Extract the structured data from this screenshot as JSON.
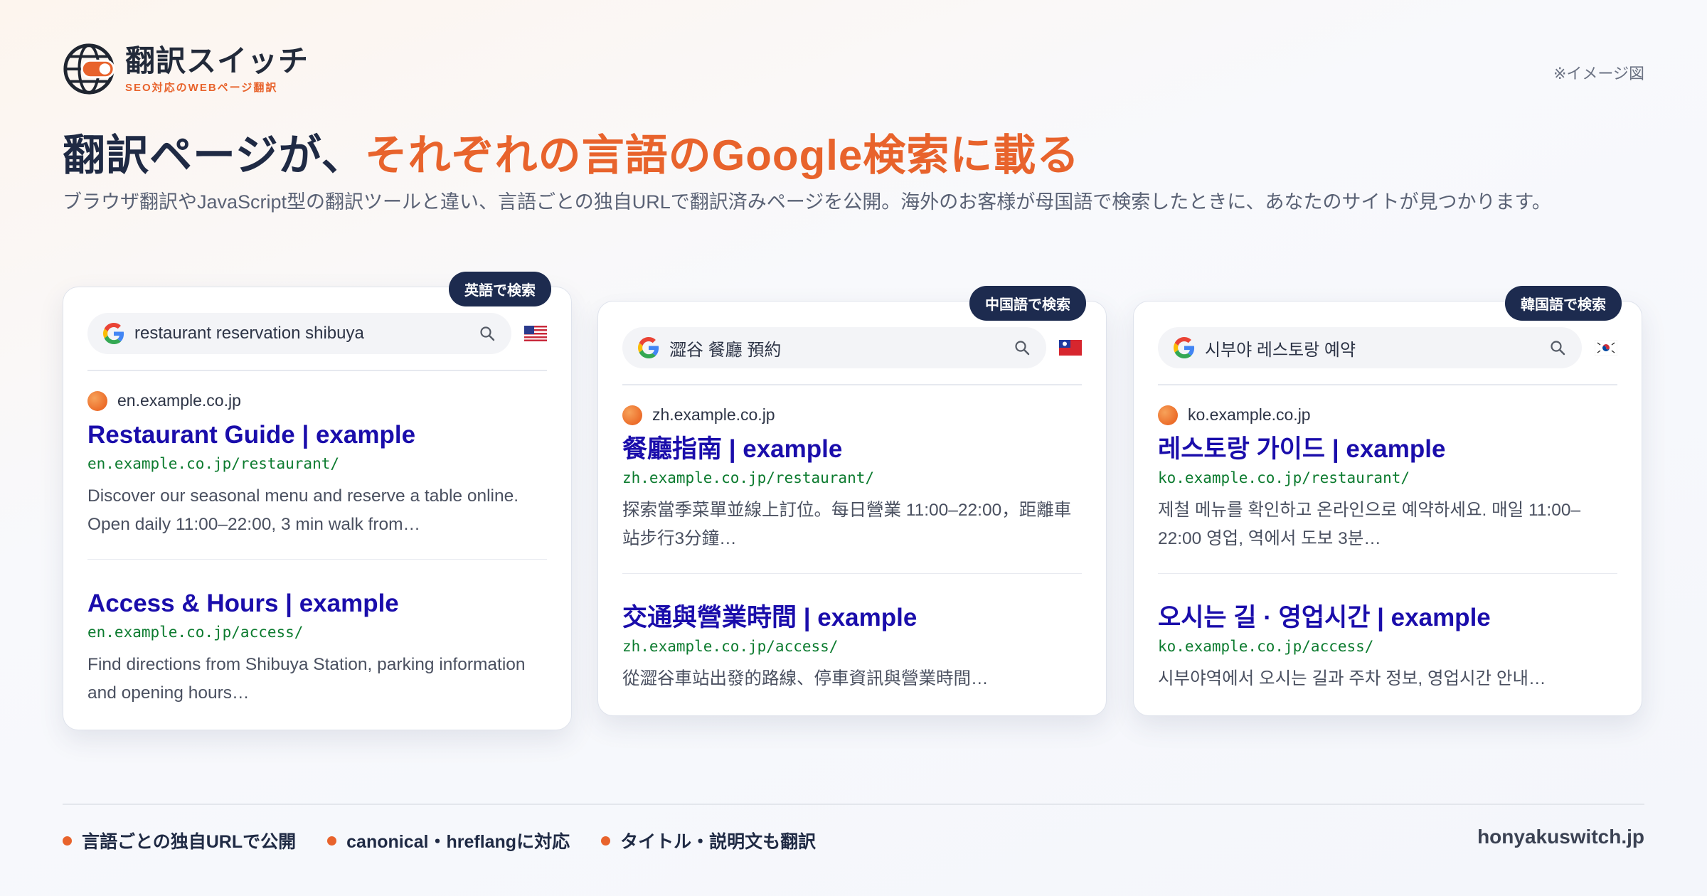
{
  "brand": {
    "name": "翻訳スイッチ",
    "tagline": "SEO対応のWEBページ翻訳",
    "accent_color": "#e8632c",
    "navy_color": "#1d2b4f"
  },
  "note": "※イメージ図",
  "headline": {
    "part1": "翻訳ページが、",
    "part2": "それぞれの言語のGoogle検索に載る"
  },
  "subtitle": "ブラウザ翻訳やJavaScript型の翻訳ツールと違い、言語ごとの独自URLで翻訳済みページを公開。海外のお客様が母国語で検索したときに、あなたのサイトが見つかります。",
  "cards": [
    {
      "badge": "英語で検索",
      "query": "restaurant reservation shibuya",
      "flag": "us-flag",
      "domain": "en.example.co.jp",
      "result1": {
        "title": "Restaurant Guide | example",
        "url": "en.example.co.jp/restaurant/",
        "desc": "Discover our seasonal menu and reserve a table online. Open daily 11:00–22:00, 3 min walk from…"
      },
      "result2": {
        "title": "Access & Hours | example",
        "url": "en.example.co.jp/access/",
        "desc": "Find directions from Shibuya Station, parking information and opening hours…"
      }
    },
    {
      "badge": "中国語で検索",
      "query": "澀谷 餐廳 預約",
      "flag": "tw-flag",
      "domain": "zh.example.co.jp",
      "result1": {
        "title": "餐廳指南 | example",
        "url": "zh.example.co.jp/restaurant/",
        "desc": "探索當季菜單並線上訂位。每日營業 11:00–22:00，距離車站步行3分鐘…"
      },
      "result2": {
        "title": "交通與營業時間 | example",
        "url": "zh.example.co.jp/access/",
        "desc": "從澀谷車站出發的路線、停車資訊與營業時間…"
      }
    },
    {
      "badge": "韓国語で検索",
      "query": "시부야 레스토랑 예약",
      "flag": "kr-flag",
      "domain": "ko.example.co.jp",
      "result1": {
        "title": "레스토랑 가이드 | example",
        "url": "ko.example.co.jp/restaurant/",
        "desc": "제철 메뉴를 확인하고 온라인으로 예약하세요. 매일 11:00–22:00 영업, 역에서 도보 3분…"
      },
      "result2": {
        "title": "오시는 길 · 영업시간 | example",
        "url": "ko.example.co.jp/access/",
        "desc": "시부야역에서 오시는 길과 주차 정보, 영업시간 안내…"
      }
    }
  ],
  "features": [
    "言語ごとの独自URLで公開",
    "canonical・hreflangに対応",
    "タイトル・説明文も翻訳"
  ],
  "site_url": "honyakuswitch.jp"
}
